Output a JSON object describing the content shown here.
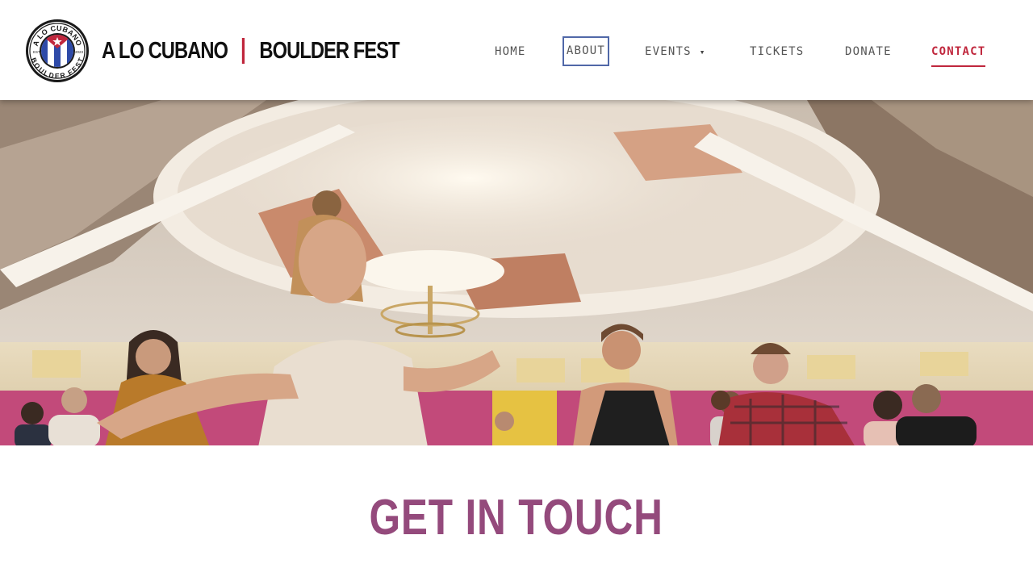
{
  "brand": {
    "logo_text_top": "A LO CUBANO",
    "logo_text_bottom": "BOULDER FEST",
    "logo_est": "EST.",
    "logo_year": "2023",
    "name_left": "A LO CUBANO",
    "name_right": "BOULDER FEST",
    "accent_color": "#c0273d"
  },
  "nav": {
    "items": [
      {
        "label": "HOME"
      },
      {
        "label": "ABOUT"
      },
      {
        "label": "EVENTS",
        "icon": "caret-down-icon",
        "caret": "▾"
      },
      {
        "label": "TICKETS"
      },
      {
        "label": "DONATE"
      },
      {
        "label": "CONTACT",
        "active": true
      }
    ]
  },
  "hero": {
    "image_description": "dance workshop in a ballroom with chandelier",
    "icon": "photo"
  },
  "section": {
    "title": "GET IN TOUCH",
    "title_color": "#944a7c"
  }
}
